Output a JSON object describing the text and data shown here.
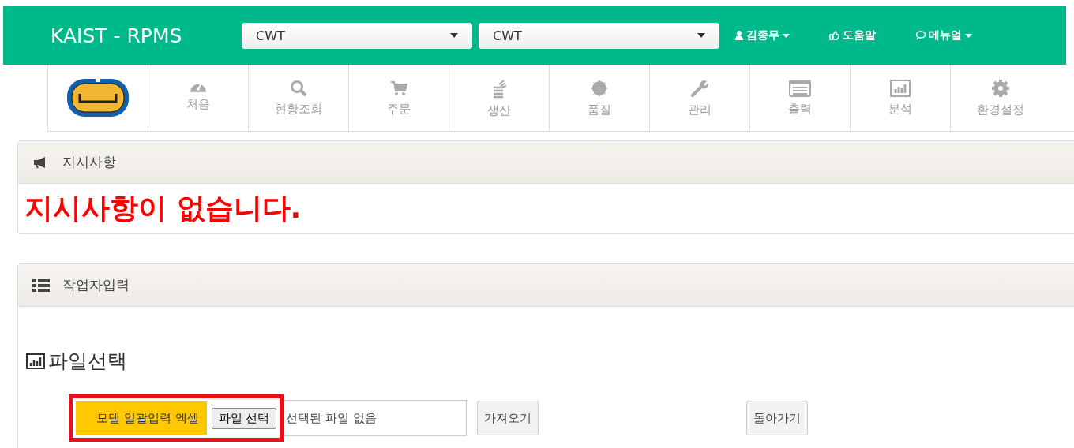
{
  "header": {
    "title": "KAIST - RPMS",
    "selects": [
      {
        "value": "CWT"
      },
      {
        "value": "CWT"
      }
    ],
    "user_menu": "김종무",
    "help": "도움말",
    "manual": "메뉴얼"
  },
  "nav": {
    "items": [
      {
        "label": "처음"
      },
      {
        "label": "현황조회"
      },
      {
        "label": "주문"
      },
      {
        "label": "생산"
      },
      {
        "label": "품질"
      },
      {
        "label": "관리"
      },
      {
        "label": "출력"
      },
      {
        "label": "분석"
      },
      {
        "label": "환경설정"
      }
    ]
  },
  "notice": {
    "title": "지시사항",
    "message": "지시사항이 없습니다."
  },
  "worker_input": {
    "title": "작업자입력",
    "section_title": "파일선택",
    "file_label": "모델 일괄입력 엑셀",
    "file_button": "파일 선택",
    "file_status": "선택된 파일 없음",
    "highlighted": true,
    "buttons": [
      "가져오기",
      "돌아가기"
    ]
  }
}
